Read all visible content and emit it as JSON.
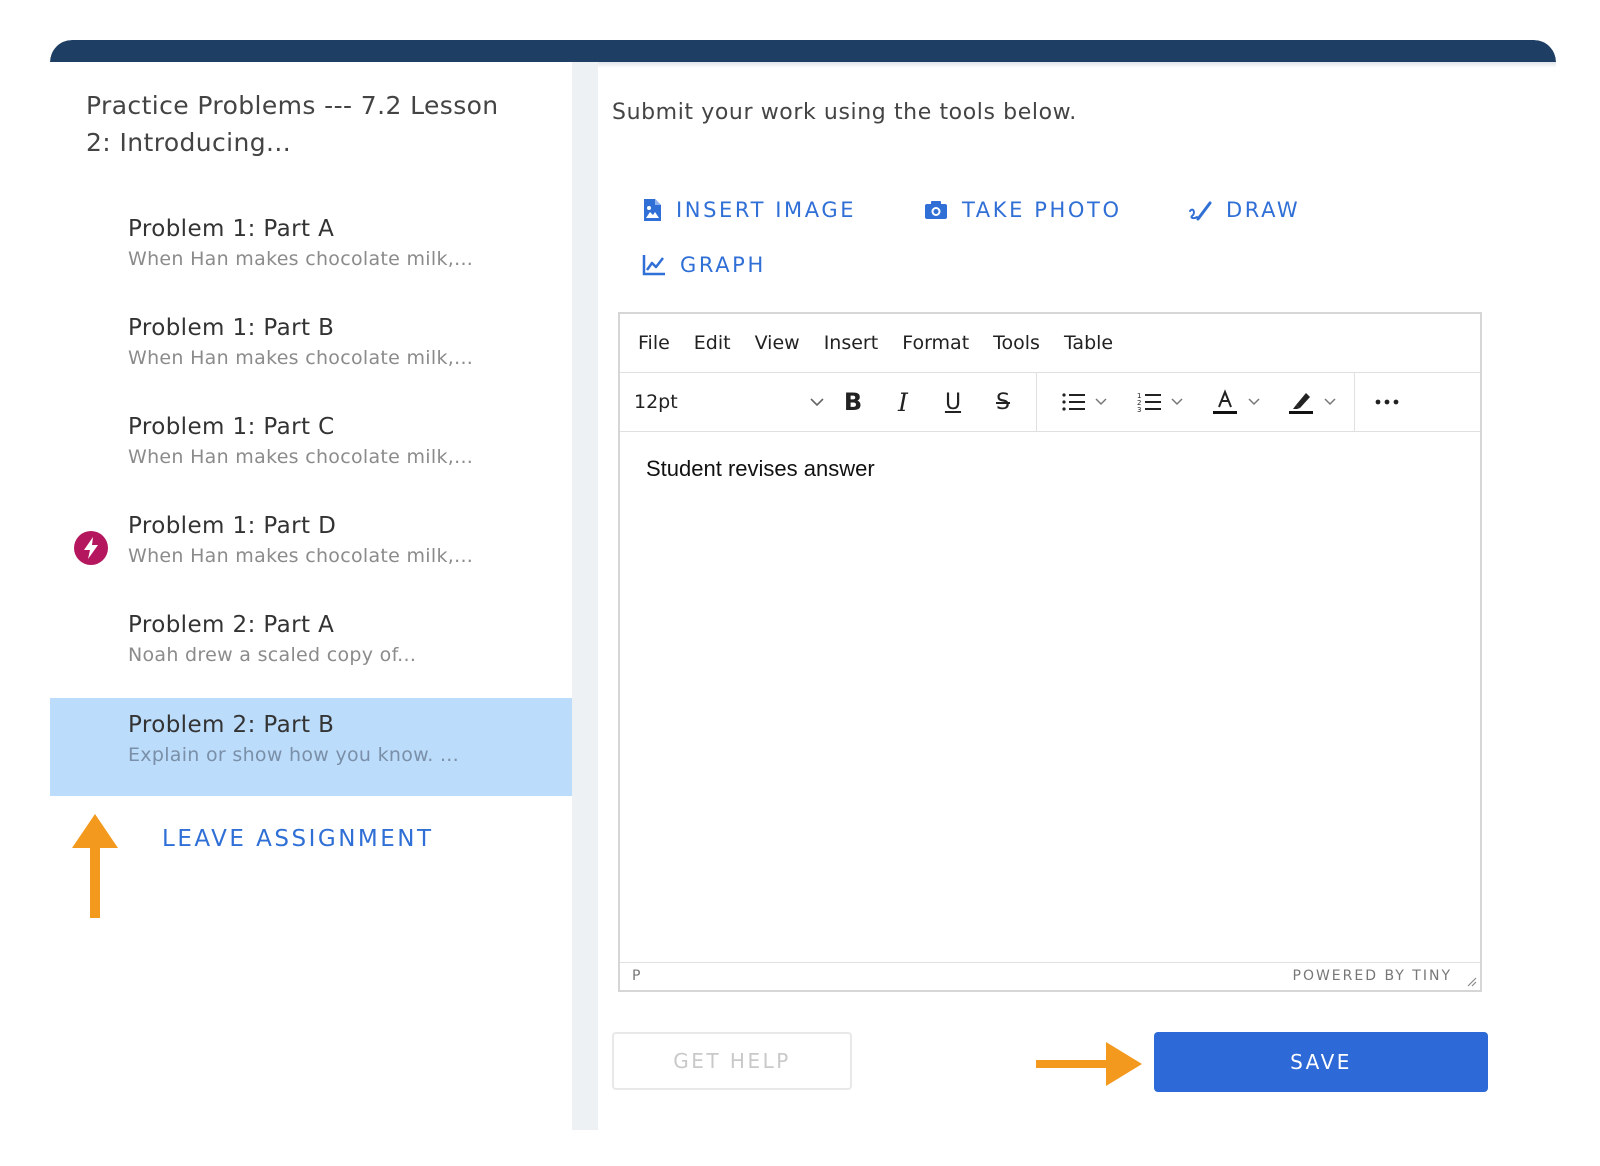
{
  "sidebar": {
    "title": "Practice Problems --- 7.2 Lesson 2: Introducing...",
    "items": [
      {
        "title": "Problem 1: Part A",
        "subtitle": "When Han makes chocolate milk,...",
        "selected": false,
        "badge": false
      },
      {
        "title": "Problem 1: Part B",
        "subtitle": "When Han makes chocolate milk,...",
        "selected": false,
        "badge": false
      },
      {
        "title": "Problem 1: Part C",
        "subtitle": "When Han makes chocolate milk,...",
        "selected": false,
        "badge": false
      },
      {
        "title": "Problem 1: Part D",
        "subtitle": "When Han makes chocolate milk,...",
        "selected": false,
        "badge": true
      },
      {
        "title": "Problem 2: Part A",
        "subtitle": "Noah drew a scaled copy of...",
        "selected": false,
        "badge": false
      },
      {
        "title": "Problem 2: Part B",
        "subtitle": "Explain or show how you know.    ...",
        "selected": true,
        "badge": false
      }
    ],
    "leave_label": "LEAVE ASSIGNMENT"
  },
  "main": {
    "instruction": "Submit your work using the tools below.",
    "tools": {
      "insert_image": "INSERT IMAGE",
      "take_photo": "TAKE PHOTO",
      "draw": "DRAW",
      "graph": "GRAPH"
    },
    "editor": {
      "menu": [
        "File",
        "Edit",
        "View",
        "Insert",
        "Format",
        "Tools",
        "Table"
      ],
      "font_size": "12pt",
      "content": "Student revises answer",
      "status_path": "P",
      "powered_by": "POWERED BY TINY"
    },
    "help_label": "GET HELP",
    "save_label": "SAVE"
  },
  "colors": {
    "topbar": "#1e3f63",
    "accent": "#2f6fd6",
    "selected_bg": "#bcdcfb",
    "badge": "#b5175f",
    "annotation_arrow": "#f39a1e"
  },
  "icons": [
    "insert-image-icon",
    "camera-icon",
    "draw-icon",
    "graph-icon",
    "bold-icon",
    "italic-icon",
    "underline-icon",
    "strikethrough-icon",
    "bullet-list-icon",
    "numbered-list-icon",
    "text-color-icon",
    "highlight-icon",
    "more-icon",
    "lightning-icon"
  ]
}
